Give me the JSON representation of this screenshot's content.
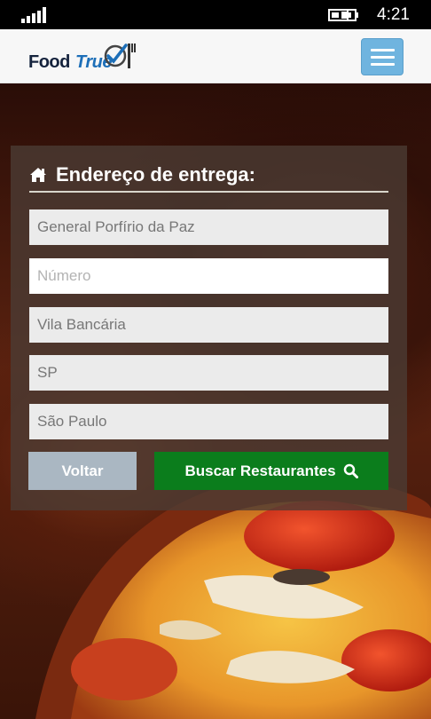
{
  "status_bar": {
    "time": "4:21",
    "signal_icon": "signal-bars-icon",
    "battery_icon": "battery-charging-icon"
  },
  "header": {
    "logo_food": "Food",
    "logo_true": "True",
    "menu_icon": "hamburger-menu-icon"
  },
  "form": {
    "title": "Endereço de entrega:",
    "title_icon": "home-icon",
    "fields": {
      "street": {
        "value": "General Porfírio da Paz",
        "placeholder": ""
      },
      "number": {
        "value": "",
        "placeholder": "Número"
      },
      "neighborhood": {
        "value": "Vila Bancária",
        "placeholder": ""
      },
      "state": {
        "value": "SP",
        "placeholder": ""
      },
      "city": {
        "value": "São Paulo",
        "placeholder": ""
      }
    },
    "back_label": "Voltar",
    "search_label": "Buscar Restaurantes",
    "search_icon": "search-icon"
  },
  "colors": {
    "menu_button": "#6fb4df",
    "search_button": "#0b7d1c",
    "back_button": "#aab7c2",
    "logo_blue": "#1d6fb8",
    "logo_dark": "#15233d"
  }
}
